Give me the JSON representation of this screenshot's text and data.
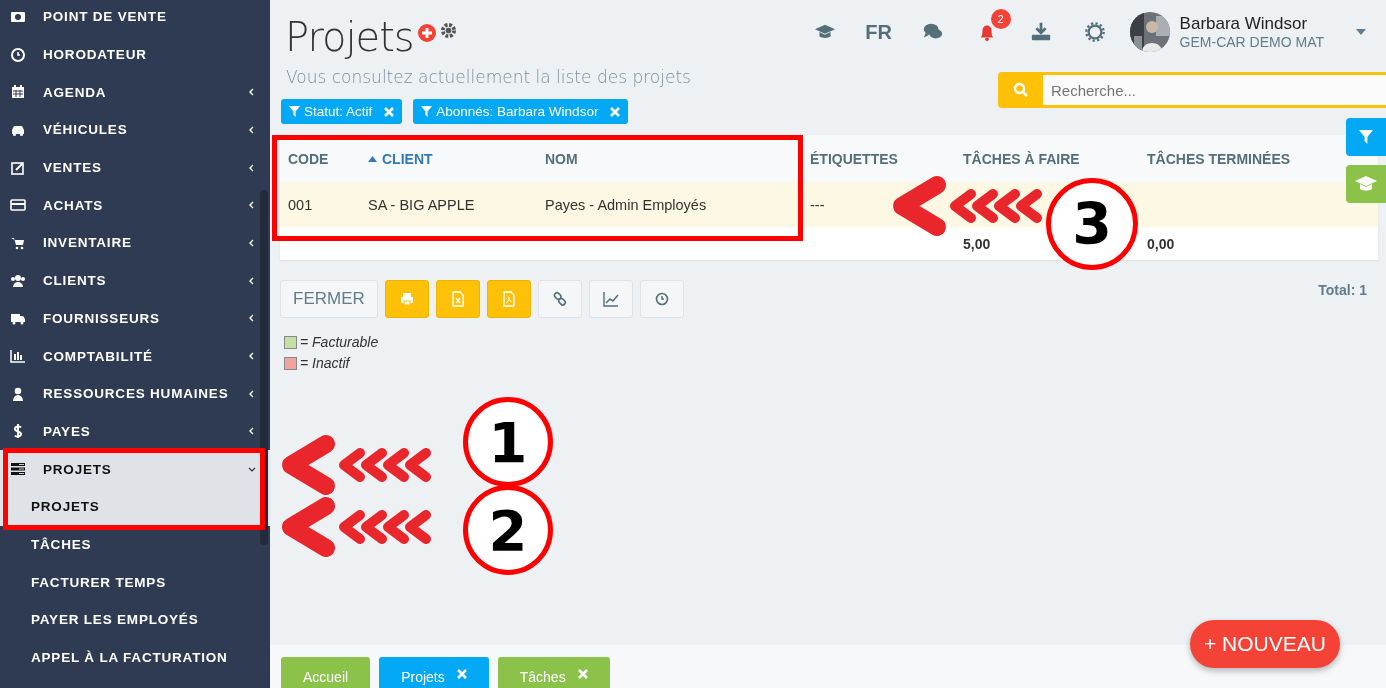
{
  "sidebar": {
    "items": [
      {
        "label": "POINT DE VENTE",
        "kind": "link"
      },
      {
        "label": "HORODATEUR",
        "kind": "link"
      },
      {
        "label": "AGENDA",
        "kind": "menu",
        "expanded": false
      },
      {
        "label": "VÉHICULES",
        "kind": "menu",
        "expanded": false
      },
      {
        "label": "VENTES",
        "kind": "menu",
        "expanded": false
      },
      {
        "label": "ACHATS",
        "kind": "menu",
        "expanded": false
      },
      {
        "label": "INVENTAIRE",
        "kind": "menu",
        "expanded": false
      },
      {
        "label": "CLIENTS",
        "kind": "menu",
        "expanded": false
      },
      {
        "label": "FOURNISSEURS",
        "kind": "menu",
        "expanded": false
      },
      {
        "label": "COMPTABILITÉ",
        "kind": "menu",
        "expanded": false
      },
      {
        "label": "RESSOURCES HUMAINES",
        "kind": "menu",
        "expanded": false
      },
      {
        "label": "PAYES",
        "kind": "menu",
        "expanded": false
      },
      {
        "label": "PROJETS",
        "kind": "menu",
        "expanded": true,
        "children": [
          {
            "label": "PROJETS",
            "selected": true
          },
          {
            "label": "TÂCHES",
            "selected": false
          },
          {
            "label": "FACTURER TEMPS",
            "selected": false
          },
          {
            "label": "PAYER LES EMPLOYÉS",
            "selected": false
          },
          {
            "label": "APPEL À LA FACTURATION",
            "selected": false
          }
        ]
      }
    ]
  },
  "header": {
    "title": "Projets",
    "subtitle": "Vous consultez actuellement la liste des projets",
    "language": "FR",
    "notifications": "2",
    "user_name": "Barbara Windsor",
    "company": "GEM-CAR DEMO MAT"
  },
  "search": {
    "placeholder": "Recherche..."
  },
  "filters": [
    "Statut: Actif",
    "Abonnés: Barbara Windsor"
  ],
  "table": {
    "columns": [
      {
        "label": "CODE",
        "sorted": false
      },
      {
        "label": "CLIENT",
        "sorted": true
      },
      {
        "label": "NOM",
        "sorted": false
      },
      {
        "label": "ÉTIQUETTES",
        "sorted": false
      },
      {
        "label": "TÂCHES À FAIRE",
        "sorted": false
      },
      {
        "label": "TÂCHES TERMINÉES",
        "sorted": false
      }
    ],
    "rows": [
      [
        "001",
        "SA - BIG APPLE",
        "Payes - Admin Employés",
        "---"
      ]
    ],
    "totals": [
      "5,00",
      "0,00"
    ]
  },
  "toolbar": {
    "close": "FERMER",
    "total": "Total: 1"
  },
  "legend": [
    {
      "label": "= Facturable",
      "color": "#c5e0a5"
    },
    {
      "label": "= Inactif",
      "color": "#f0a39c"
    }
  ],
  "bottom_tabs": [
    {
      "label": "Accueil",
      "color": "#8bc34a",
      "closable": false
    },
    {
      "label": "Projets",
      "color": "#03a9f4",
      "closable": true
    },
    {
      "label": "Tâches",
      "color": "#8bc34a",
      "closable": true
    }
  ],
  "new_button": "+ NOUVEAU",
  "annotations": [
    {
      "label": "1"
    },
    {
      "label": "2"
    },
    {
      "label": "3"
    }
  ]
}
